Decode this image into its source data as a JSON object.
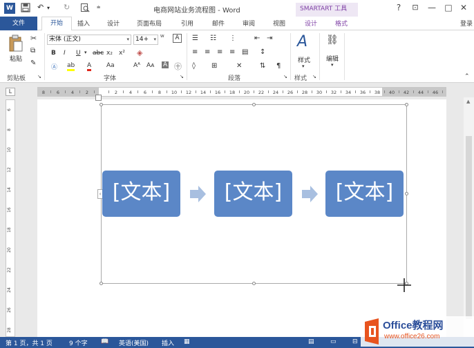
{
  "titlebar": {
    "app_icon": "W",
    "title": "电商网站业务流程图 - Word",
    "context_tab": "SMARTART 工具",
    "help": "?",
    "ribbon_display": "⊡",
    "minimize": "—",
    "maximize": "□",
    "close": "✕"
  },
  "tabs": {
    "file": "文件",
    "home": "开始",
    "insert": "插入",
    "design": "设计",
    "page_layout": "页面布局",
    "references": "引用",
    "mailings": "邮件",
    "review": "审阅",
    "view": "视图",
    "sa_design": "设计",
    "sa_format": "格式",
    "login": "登录"
  },
  "ribbon": {
    "paste_label": "粘贴",
    "font_name": "宋体 (正文)",
    "font_size": "14+",
    "styles_label": "样式",
    "editing_label": "编辑",
    "groups": {
      "clipboard": "剪贴板",
      "font": "字体",
      "paragraph": "段落",
      "styles": "样式"
    }
  },
  "ruler": {
    "corner": "L",
    "h_ticks": [
      "8",
      "6",
      "4",
      "2",
      "",
      "2",
      "4",
      "6",
      "8",
      "10",
      "12",
      "14",
      "16",
      "18",
      "20",
      "22",
      "24",
      "26",
      "28",
      "30",
      "32",
      "34",
      "36",
      "38",
      "40",
      "42",
      "44",
      "46",
      "48"
    ],
    "v_ticks": [
      "6",
      "8",
      "10",
      "12",
      "14",
      "16",
      "18",
      "20",
      "22",
      "24",
      "26",
      "28"
    ]
  },
  "smartart": {
    "boxes": [
      "[文本]",
      "[文本]",
      "[文本]"
    ],
    "box_color": "#5b87c7",
    "arrow_color": "#a8bfe0"
  },
  "statusbar": {
    "page": "第 1 页，共 1 页",
    "words": "9 个字",
    "language": "英语(美国)",
    "mode": "插入"
  },
  "watermark": {
    "brand": "Office教程网",
    "url": "www.office26.com"
  },
  "colors": {
    "accent": "#2b579a",
    "smartart_context": "#7e3fa5"
  }
}
